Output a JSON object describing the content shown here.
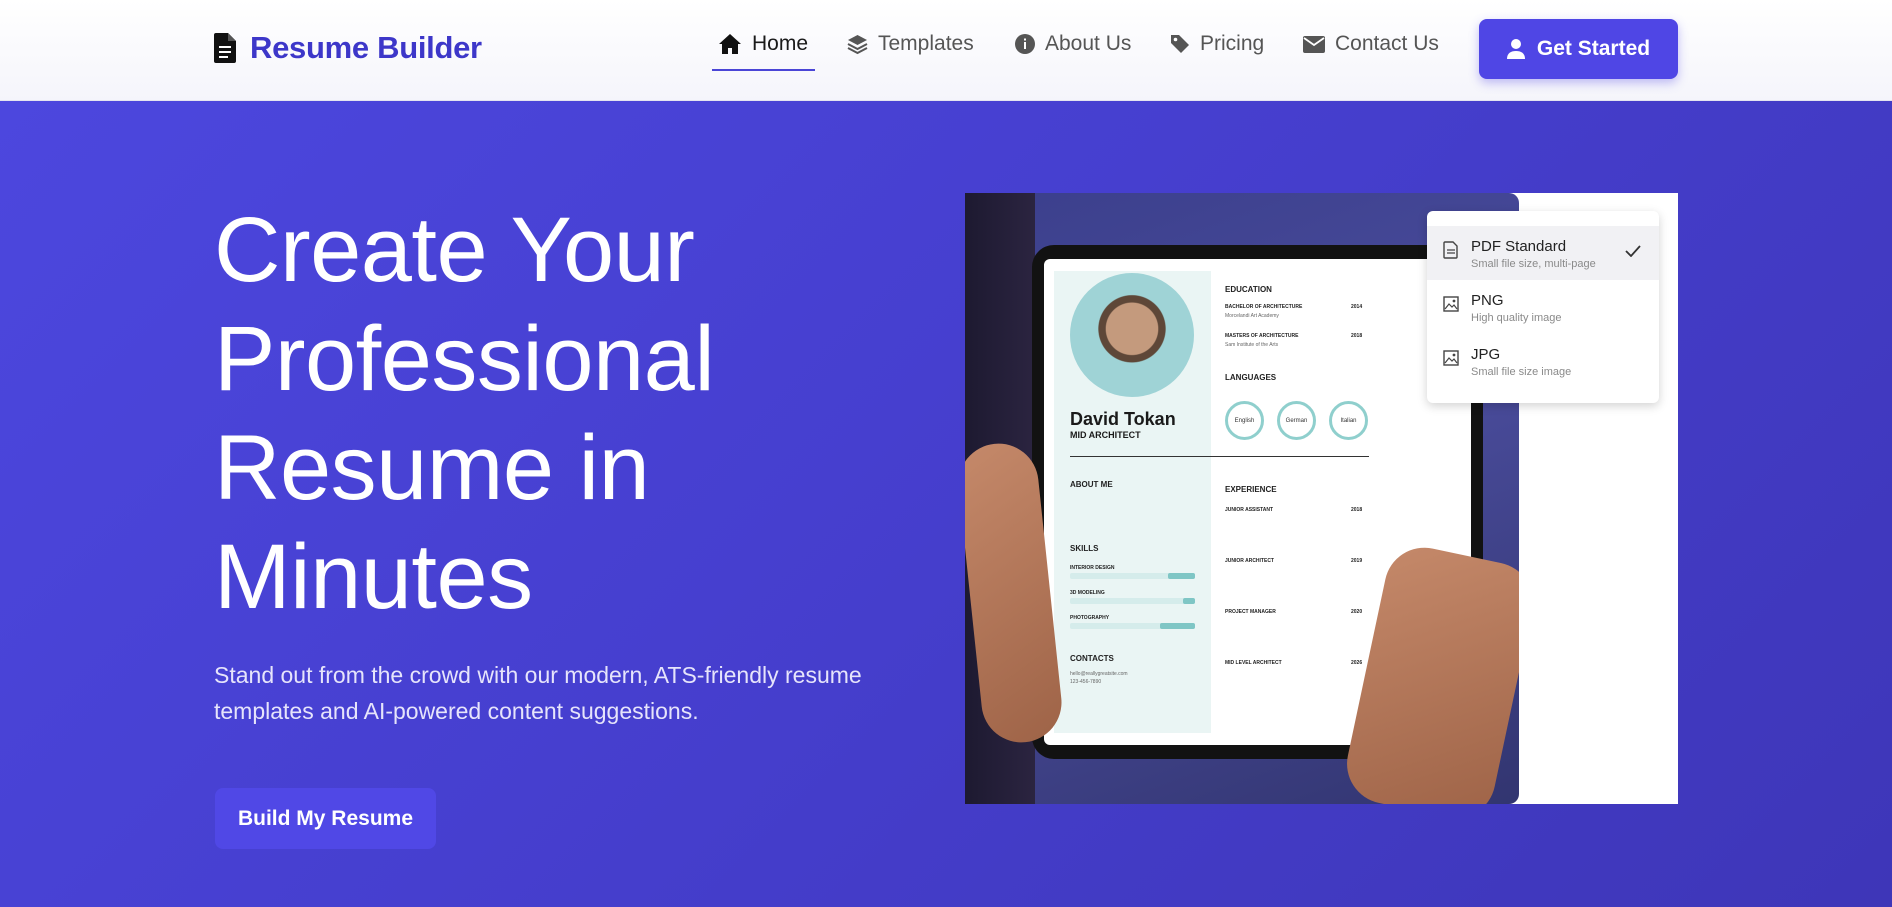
{
  "brand": {
    "name": "Resume Builder"
  },
  "nav": {
    "items": [
      {
        "label": "Home",
        "icon": "home-icon",
        "active": true
      },
      {
        "label": "Templates",
        "icon": "layers-icon"
      },
      {
        "label": "About Us",
        "icon": "info-icon"
      },
      {
        "label": "Pricing",
        "icon": "tag-icon"
      },
      {
        "label": "Contact Us",
        "icon": "envelope-icon"
      }
    ],
    "cta": "Get Started"
  },
  "hero": {
    "title": "Create Your Professional Resume in Minutes",
    "subtitle": "Stand out from the crowd with our modern, ATS-friendly resume templates and AI-powered content suggestions.",
    "button": "Build My Resume"
  },
  "export_menu": {
    "items": [
      {
        "title": "PDF Standard",
        "sub": "Small file size, multi-page",
        "icon": "file-icon",
        "selected": true
      },
      {
        "title": "PNG",
        "sub": "High quality image",
        "icon": "image-icon"
      },
      {
        "title": "JPG",
        "sub": "Small file size image",
        "icon": "image-icon"
      }
    ]
  },
  "resume": {
    "name": "David Tokan",
    "role": "MID ARCHITECT",
    "about_heading": "ABOUT ME",
    "skills_heading": "SKILLS",
    "skills": [
      {
        "name": "INTERIOR DESIGN",
        "level": 0.2
      },
      {
        "name": "3D MODELING",
        "level": 0.1
      },
      {
        "name": "PHOTOGRAPHY",
        "level": 0.3
      }
    ],
    "contacts_heading": "CONTACTS",
    "contacts": [
      "hello@reallygreatsite.com",
      "123-456-7890"
    ],
    "education_heading": "EDUCATION",
    "education": [
      {
        "degree": "BACHELOR OF ARCHITECTURE",
        "year": "2014",
        "school": "Morcelandi Art Academy"
      },
      {
        "degree": "MASTERS OF ARCHITECTURE",
        "year": "2018",
        "school": "Sam Institute of the Arts"
      }
    ],
    "languages_heading": "LANGUAGES",
    "languages": [
      "English",
      "German",
      "Italian"
    ],
    "experience_heading": "EXPERIENCE",
    "experience": [
      {
        "title": "JUNIOR ASSISTANT",
        "year": "2018"
      },
      {
        "title": "JUNIOR ARCHITECT",
        "year": "2019"
      },
      {
        "title": "PROJECT MANAGER",
        "year": "2020"
      },
      {
        "title": "MID LEVEL ARCHITECT",
        "year": "2026"
      }
    ]
  },
  "colors": {
    "accent": "#4f46e5",
    "brand_text": "#3d37c9",
    "hero_bg": "#463fcf"
  }
}
